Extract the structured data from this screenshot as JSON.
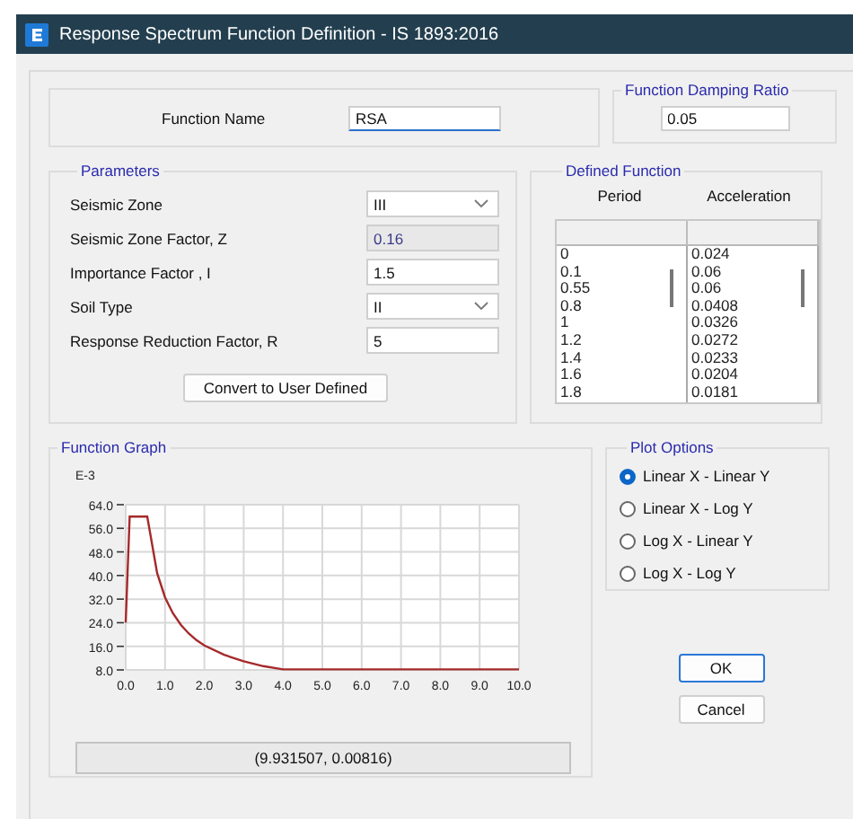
{
  "window": {
    "title": "Response Spectrum Function Definition - IS 1893:2016"
  },
  "function_name": {
    "label": "Function Name",
    "value": "RSA"
  },
  "damping": {
    "title": "Function Damping Ratio",
    "value": "0.05"
  },
  "parameters": {
    "title": "Parameters",
    "fields": [
      {
        "kind": "dropdown",
        "label": "Seismic Zone",
        "value": "III"
      },
      {
        "kind": "readonly",
        "label": "Seismic Zone Factor, Z",
        "value": "0.16"
      },
      {
        "kind": "text",
        "label": "Importance Factor , I",
        "value": "1.5"
      },
      {
        "kind": "dropdown",
        "label": "Soil Type",
        "value": "II"
      },
      {
        "kind": "text",
        "label": "Response Reduction Factor, R",
        "value": "5"
      }
    ],
    "button": "Convert to User Defined"
  },
  "defined_function": {
    "title": "Defined Function",
    "columns": [
      "Period",
      "Acceleration"
    ],
    "rows": [
      [
        "0",
        "0.024"
      ],
      [
        "0.1",
        "0.06"
      ],
      [
        "0.55",
        "0.06"
      ],
      [
        "0.8",
        "0.0408"
      ],
      [
        "1",
        "0.0326"
      ],
      [
        "1.2",
        "0.0272"
      ],
      [
        "1.4",
        "0.0233"
      ],
      [
        "1.6",
        "0.0204"
      ],
      [
        "1.8",
        "0.0181"
      ]
    ]
  },
  "function_graph": {
    "title": "Function Graph",
    "chart_data": {
      "type": "line",
      "ylabel": "E-3",
      "x": [
        0,
        0.1,
        0.55,
        0.8,
        1,
        1.2,
        1.4,
        1.6,
        1.8,
        2,
        2.5,
        3,
        3.5,
        4,
        10
      ],
      "series": [
        {
          "color": "#a52a2a",
          "values": [
            24,
            60,
            60,
            40.8,
            32.6,
            27.2,
            23.3,
            20.4,
            18.1,
            16.3,
            13.1,
            10.9,
            9.3,
            8.2,
            8.2
          ]
        }
      ],
      "xlim": [
        0,
        10
      ],
      "ylim": [
        8,
        64
      ],
      "grid": true,
      "xticks": [
        {
          "value": 0,
          "label": "0.0"
        },
        {
          "value": 1,
          "label": "1.0"
        },
        {
          "value": 2,
          "label": "2.0"
        },
        {
          "value": 3,
          "label": "3.0"
        },
        {
          "value": 4,
          "label": "4.0"
        },
        {
          "value": 5,
          "label": "5.0"
        },
        {
          "value": 6,
          "label": "6.0"
        },
        {
          "value": 7,
          "label": "7.0"
        },
        {
          "value": 8,
          "label": "8.0"
        },
        {
          "value": 9,
          "label": "9.0"
        },
        {
          "value": 10,
          "label": "10.0"
        }
      ],
      "yticks": [
        {
          "value": 8,
          "label": "8.0"
        },
        {
          "value": 16,
          "label": "16.0"
        },
        {
          "value": 24,
          "label": "24.0"
        },
        {
          "value": 32,
          "label": "32.0"
        },
        {
          "value": 40,
          "label": "40.0"
        },
        {
          "value": 48,
          "label": "48.0"
        },
        {
          "value": 56,
          "label": "56.0"
        },
        {
          "value": 64,
          "label": "64.0"
        }
      ]
    },
    "readout": "(9.931507, 0.00816)"
  },
  "plot_options": {
    "title": "Plot Options",
    "options": [
      {
        "label": "Linear X - Linear Y",
        "selected": true
      },
      {
        "label": "Linear X - Log Y",
        "selected": false
      },
      {
        "label": "Log X - Linear Y",
        "selected": false
      },
      {
        "label": "Log X - Log Y",
        "selected": false
      }
    ]
  },
  "buttons": [
    {
      "label": "OK",
      "default": true
    },
    {
      "label": "Cancel",
      "default": false
    }
  ]
}
